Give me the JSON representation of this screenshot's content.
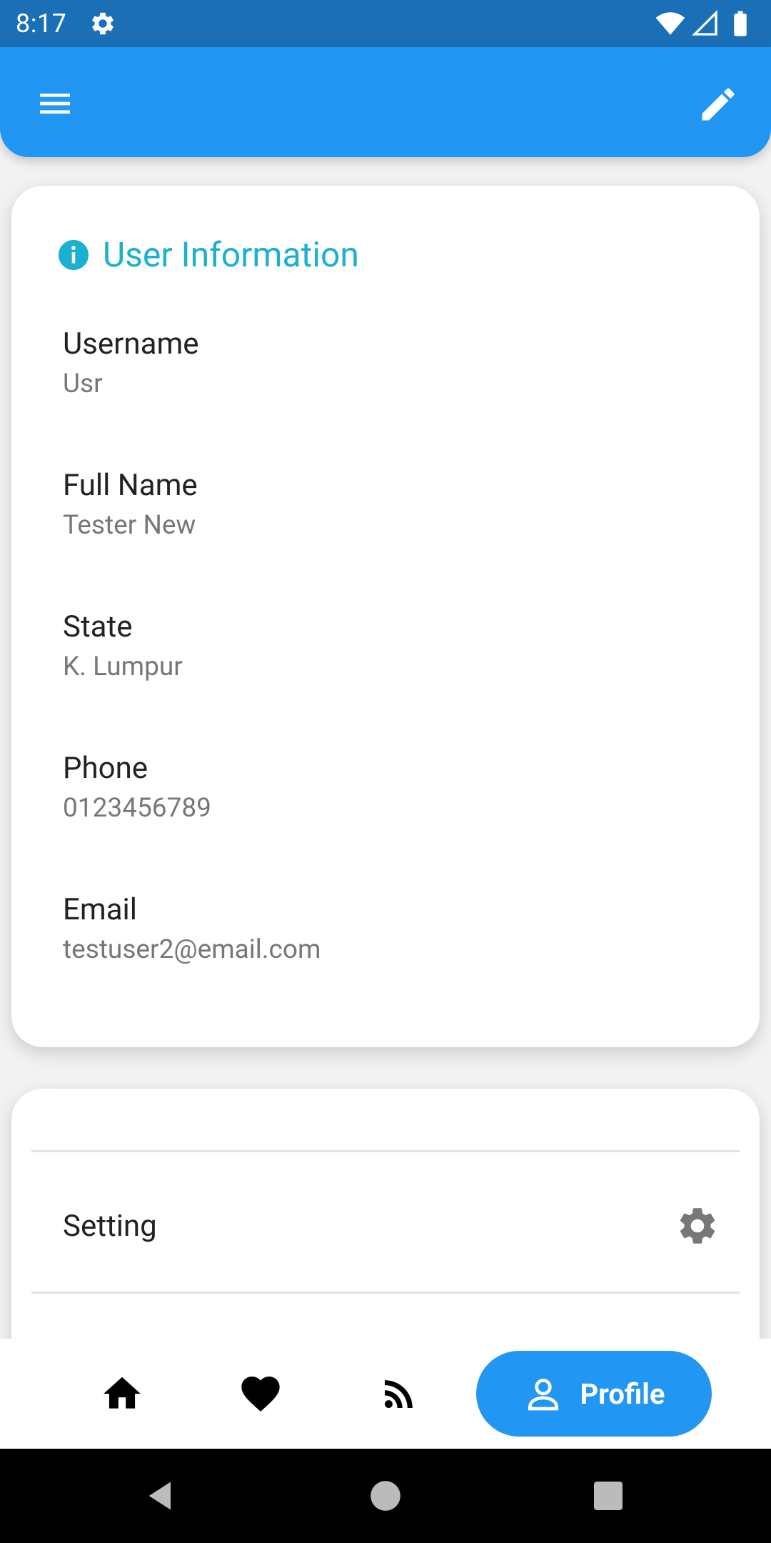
{
  "status_bar": {
    "time": "8:17"
  },
  "app_bar": {
    "menu_icon": "menu-icon",
    "edit_icon": "edit-icon"
  },
  "user_info": {
    "title": "User Information",
    "fields": [
      {
        "label": "Username",
        "value": "Usr"
      },
      {
        "label": "Full Name",
        "value": "Tester New"
      },
      {
        "label": "State",
        "value": "K. Lumpur"
      },
      {
        "label": "Phone",
        "value": "0123456789"
      },
      {
        "label": "Email",
        "value": "testuser2@email.com"
      }
    ]
  },
  "settings": {
    "label": "Setting"
  },
  "bottom_nav": {
    "items": [
      {
        "icon": "home-icon"
      },
      {
        "icon": "heart-icon"
      },
      {
        "icon": "rss-icon"
      },
      {
        "icon": "person-icon",
        "label": "Profile",
        "active": true
      }
    ]
  },
  "colors": {
    "primary": "#2196f3",
    "status_bar": "#1b6fb7",
    "info_accent": "#1bb0d0",
    "value_text": "#777777"
  }
}
